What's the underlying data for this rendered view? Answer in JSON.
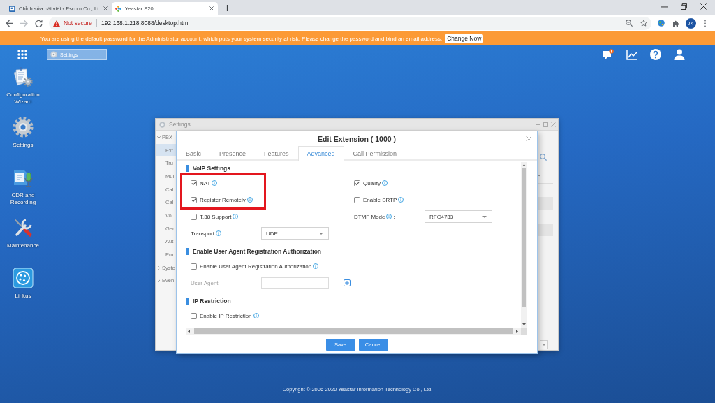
{
  "browser": {
    "tabs": [
      {
        "kind": "page",
        "title": "Chỉnh sửa bài viết ‹ Escom Co., Lt",
        "selected": false
      },
      {
        "kind": "pinwheel",
        "title": "Yeastar S20",
        "selected": true
      }
    ],
    "security_label": "Not secure",
    "url": "192.168.1.218:8088/desktop.html",
    "profile": "JK"
  },
  "banner": {
    "message": "You are using the default password for the Administrator account, which puts your system security at risk. Please change the password and bind an email address.",
    "button": "Change Now"
  },
  "taskbar": {
    "items": [
      {
        "label": "Settings",
        "selected": true
      }
    ],
    "notification": true
  },
  "desktop_icons": [
    {
      "kind": "wizard",
      "label": "Configuration Wizard"
    },
    {
      "kind": "gear",
      "label": "Settings"
    },
    {
      "kind": "recording",
      "label": "CDR and Recording"
    },
    {
      "kind": "tools",
      "label": "Maintenance"
    },
    {
      "kind": "app",
      "label": "Linkus"
    }
  ],
  "settings_window": {
    "title": "Settings",
    "nav": [
      {
        "label": "PBX",
        "expanded": true,
        "children": [
          {
            "label": "Ext",
            "selected": true
          },
          {
            "label": "Tru",
            "selected": false
          },
          {
            "label": "Mul",
            "selected": false
          },
          {
            "label": "Cal",
            "selected": false
          },
          {
            "label": "Cal",
            "selected": false
          },
          {
            "label": "Voi",
            "selected": false
          },
          {
            "label": "Gen",
            "selected": false
          },
          {
            "label": "Aut",
            "selected": false
          },
          {
            "label": "Em",
            "selected": false
          }
        ]
      },
      {
        "label": "Syste",
        "expanded": false
      },
      {
        "label": "Even",
        "expanded": false
      }
    ],
    "column_1": "e"
  },
  "dialog": {
    "title": "Edit Extension ( 1000 )",
    "tabs": [
      {
        "label": "Basic",
        "selected": false
      },
      {
        "label": "Presence",
        "selected": false
      },
      {
        "label": "Features",
        "selected": false
      },
      {
        "label": "Advanced",
        "selected": true
      },
      {
        "label": "Call Permission",
        "selected": false
      }
    ],
    "sections": [
      {
        "title": "VoIP Settings",
        "columns": [
          {
            "highlighted": [
              {
                "kind": "checkbox",
                "label": "NAT",
                "checked": true,
                "info": true
              },
              {
                "kind": "checkbox",
                "label": "Register Remotely",
                "checked": true,
                "info": true
              }
            ],
            "items": [
              {
                "kind": "checkbox",
                "label": "T.38 Support",
                "checked": false,
                "info": true
              },
              {
                "kind": "select",
                "label": "Transport",
                "info": true,
                "suffix": ":",
                "value": "UDP"
              }
            ]
          },
          {
            "items": [
              {
                "kind": "checkbox",
                "label": "Qualify",
                "checked": true,
                "info": true
              },
              {
                "kind": "checkbox",
                "label": "Enable SRTP",
                "checked": false,
                "info": true
              },
              {
                "kind": "select",
                "label": "DTMF Mode",
                "info": true,
                "suffix": ":",
                "value": "RFC4733"
              }
            ]
          }
        ]
      },
      {
        "title": "Enable User Agent Registration Authorization",
        "columns": [
          {
            "items": [
              {
                "kind": "checkbox",
                "label": "Enable User Agent Registration Authorization",
                "checked": false,
                "info": true
              },
              {
                "kind": "input",
                "label": "User Agent:",
                "info": false,
                "disabled": true,
                "add_button": true
              }
            ]
          }
        ]
      },
      {
        "title": "IP Restriction",
        "columns": [
          {
            "items": [
              {
                "kind": "checkbox",
                "label": "Enable IP Restriction",
                "checked": false,
                "info": true
              }
            ]
          }
        ]
      }
    ],
    "buttons": [
      {
        "label": "Save"
      },
      {
        "label": "Cancel"
      }
    ]
  },
  "footer": "Copyright © 2006-2020 Yeastar Information Technology Co., Ltd."
}
